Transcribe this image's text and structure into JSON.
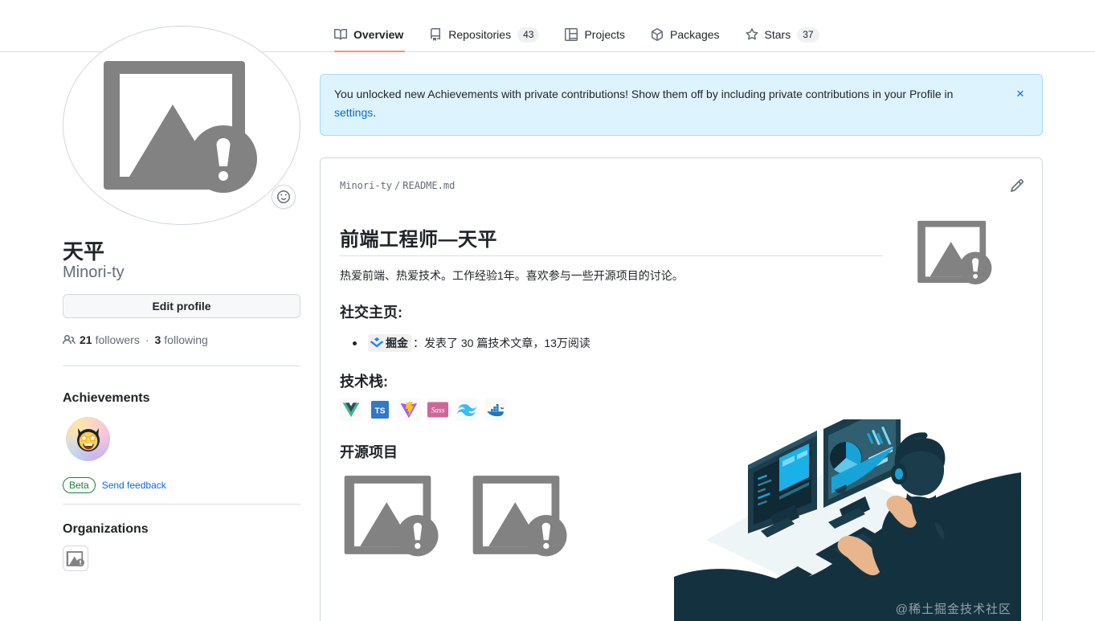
{
  "nav": {
    "tabs": [
      {
        "label": "Overview",
        "icon": "book-icon",
        "count": null,
        "active": true
      },
      {
        "label": "Repositories",
        "icon": "repo-icon",
        "count": "43",
        "active": false
      },
      {
        "label": "Projects",
        "icon": "table-icon",
        "count": null,
        "active": false
      },
      {
        "label": "Packages",
        "icon": "package-icon",
        "count": null,
        "active": false
      },
      {
        "label": "Stars",
        "icon": "star-icon",
        "count": "37",
        "active": false
      }
    ]
  },
  "banner": {
    "text_before": "You unlocked new Achievements with private contributions! Show them off by including private contributions in your Profile in ",
    "link": "settings",
    "text_after": ".",
    "close_label": "×"
  },
  "profile": {
    "avatar_alt": "broken-image-placeholder",
    "status_icon": "smiley-icon",
    "name": "天平",
    "login": "Minori-ty",
    "edit_button": "Edit profile",
    "followers_count": "21",
    "followers_label": "followers",
    "separator": "·",
    "following_count": "3",
    "following_label": "following"
  },
  "achievements": {
    "title": "Achievements",
    "badge_alt": "star-struck-octocat-badge",
    "beta_label": "Beta",
    "feedback_label": "Send feedback"
  },
  "organizations": {
    "title": "Organizations",
    "org_alt": "broken-image-placeholder"
  },
  "readme": {
    "owner": "Minori-ty",
    "separator": "/",
    "file": "README.md",
    "edit_icon": "pencil-icon",
    "heading": "前端工程师—天平",
    "intro": "热爱前端、热爱技术。工作经验1年。喜欢参与一些开源项目的讨论。",
    "section_social": "社交主页:",
    "social_item": {
      "badge_text": "掘金",
      "badge_icon": "juejin-icon",
      "description": "：发表了 30 篇技术文章，13万阅读"
    },
    "section_stack": "技术栈:",
    "stack_icons": [
      {
        "name": "vue-icon",
        "label": "Vue"
      },
      {
        "name": "typescript-icon",
        "label": "TypeScript"
      },
      {
        "name": "vite-icon",
        "label": "Vite"
      },
      {
        "name": "sass-icon",
        "label": "Sass"
      },
      {
        "name": "tailwind-icon",
        "label": "Tailwind CSS"
      },
      {
        "name": "docker-icon",
        "label": "Docker"
      }
    ],
    "section_projects": "开源项目",
    "project_images": [
      {
        "alt": "broken-image-placeholder"
      },
      {
        "alt": "broken-image-placeholder"
      }
    ],
    "illustration_alt": "developer-at-desk-illustration",
    "watermark": "@稀土掘金技术社区"
  },
  "colors": {
    "accent": "#0969da",
    "active_tab_underline": "#fd8c73",
    "banner_bg": "#ddf4ff",
    "beta_green": "#1a7f37",
    "border": "#d0d7de",
    "muted_text": "#636c76",
    "illustration_dark": "#14313f",
    "illustration_blue": "#17a3d6"
  }
}
